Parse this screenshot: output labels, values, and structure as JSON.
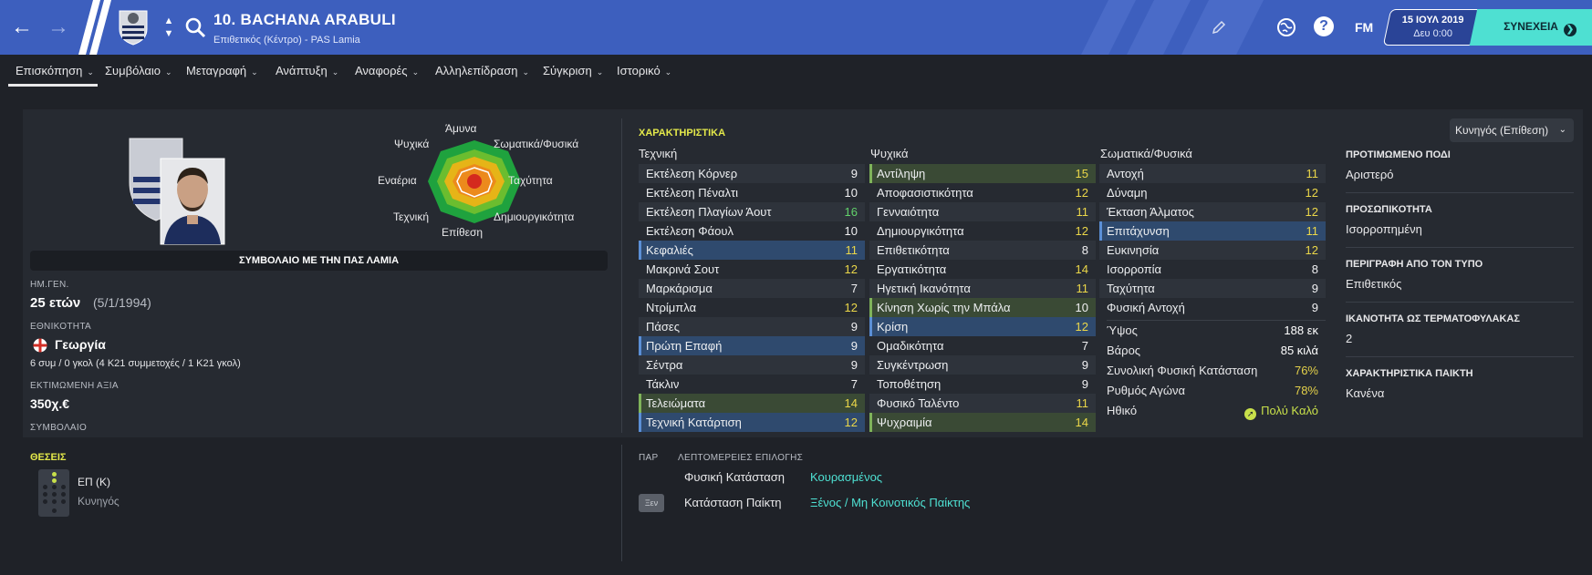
{
  "header": {
    "player_name": "10. BACHANA ARABULI",
    "player_subtitle": "Επιθετικός (Κέντρο) - PAS Lamia",
    "fm_label": "FM",
    "help_label": "?",
    "date": "15 ΙΟΥΛ 2019",
    "day_time": "Δευ 0:00",
    "continue_label": "ΣΥΝΕΧΕΙΑ",
    "accent_color": "#3d5fbe",
    "continue_color": "#4ee0d2"
  },
  "tabs": [
    {
      "label": "Επισκόπηση"
    },
    {
      "label": "Συμβόλαιο"
    },
    {
      "label": "Μεταγραφή"
    },
    {
      "label": "Ανάπτυξη"
    },
    {
      "label": "Αναφορές"
    },
    {
      "label": "Αλληλεπίδραση"
    },
    {
      "label": "Σύγκριση"
    },
    {
      "label": "Ιστορικό"
    }
  ],
  "profile": {
    "contract_banner": "ΣΥΜΒΟΛΑΙΟ ΜΕ ΤΗΝ ΠΑΣ ΛΑΜΙΑ",
    "dob_label": "ΗΜ.ΓΕΝ.",
    "age": "25 ετών",
    "dob": "(5/1/1994)",
    "nationality_label": "ΕΘΝΙΚΟΤΗΤΑ",
    "nationality": "Γεωργία",
    "caps": "6 συμ / 0 γκολ (4 K21 συμμετοχές / 1 K21 γκολ)",
    "value_label": "ΕΚΤΙΜΩΜΕΝΗ ΑΞΙΑ",
    "value": "350χ.€",
    "contract_label": "ΣΥΜΒΟΛΑΙΟ"
  },
  "radar": {
    "top": "Άμυνα",
    "top_right": "Σωματικά/Φυσικά",
    "right": "Ταχύτητα",
    "bottom_right": "Δημιουργικότητα",
    "bottom": "Επίθεση",
    "bottom_left": "Τεχνική",
    "left": "Εναέρια",
    "top_left": "Ψυχικά"
  },
  "attributes": {
    "title": "ΧΑΡΑΚΤΗΡΙΣΤΙΚΑ",
    "technical_head": "Τεχνική",
    "mental_head": "Ψυχικά",
    "physical_head": "Σωματικά/Φυσικά",
    "technical": [
      {
        "name": "Εκτέλεση Κόρνερ",
        "value": "9",
        "hl": ""
      },
      {
        "name": "Εκτέλεση Πέναλτι",
        "value": "10",
        "hl": ""
      },
      {
        "name": "Εκτέλεση Πλαγίων Άουτ",
        "value": "16",
        "hl": ""
      },
      {
        "name": "Εκτέλεση Φάουλ",
        "value": "10",
        "hl": ""
      },
      {
        "name": "Κεφαλιές",
        "value": "11",
        "hl": "blue"
      },
      {
        "name": "Μακρινά Σουτ",
        "value": "12",
        "hl": ""
      },
      {
        "name": "Μαρκάρισμα",
        "value": "7",
        "hl": ""
      },
      {
        "name": "Ντρίμπλα",
        "value": "12",
        "hl": ""
      },
      {
        "name": "Πάσες",
        "value": "9",
        "hl": ""
      },
      {
        "name": "Πρώτη Επαφή",
        "value": "9",
        "hl": "blue"
      },
      {
        "name": "Σέντρα",
        "value": "9",
        "hl": ""
      },
      {
        "name": "Τάκλιν",
        "value": "7",
        "hl": ""
      },
      {
        "name": "Τελειώματα",
        "value": "14",
        "hl": "green"
      },
      {
        "name": "Τεχνική Κατάρτιση",
        "value": "12",
        "hl": "blue"
      }
    ],
    "mental": [
      {
        "name": "Αντίληψη",
        "value": "15",
        "hl": "green"
      },
      {
        "name": "Αποφασιστικότητα",
        "value": "12",
        "hl": ""
      },
      {
        "name": "Γενναιότητα",
        "value": "11",
        "hl": ""
      },
      {
        "name": "Δημιουργικότητα",
        "value": "12",
        "hl": ""
      },
      {
        "name": "Επιθετικότητα",
        "value": "8",
        "hl": ""
      },
      {
        "name": "Εργατικότητα",
        "value": "14",
        "hl": ""
      },
      {
        "name": "Ηγετική Ικανότητα",
        "value": "11",
        "hl": ""
      },
      {
        "name": "Κίνηση Χωρίς την Μπάλα",
        "value": "10",
        "hl": "green"
      },
      {
        "name": "Κρίση",
        "value": "12",
        "hl": "blue"
      },
      {
        "name": "Ομαδικότητα",
        "value": "7",
        "hl": ""
      },
      {
        "name": "Συγκέντρωση",
        "value": "9",
        "hl": ""
      },
      {
        "name": "Τοποθέτηση",
        "value": "9",
        "hl": ""
      },
      {
        "name": "Φυσικό Ταλέντο",
        "value": "11",
        "hl": ""
      },
      {
        "name": "Ψυχραιμία",
        "value": "14",
        "hl": "green"
      }
    ],
    "physical": [
      {
        "name": "Αντοχή",
        "value": "11",
        "hl": ""
      },
      {
        "name": "Δύναμη",
        "value": "12",
        "hl": ""
      },
      {
        "name": "Έκταση Άλματος",
        "value": "12",
        "hl": ""
      },
      {
        "name": "Επιτάχυνση",
        "value": "11",
        "hl": "blue"
      },
      {
        "name": "Ευκινησία",
        "value": "12",
        "hl": ""
      },
      {
        "name": "Ισορροπία",
        "value": "8",
        "hl": ""
      },
      {
        "name": "Ταχύτητα",
        "value": "9",
        "hl": ""
      },
      {
        "name": "Φυσική Αντοχή",
        "value": "9",
        "hl": ""
      }
    ],
    "extra": {
      "height_label": "Ύψος",
      "height": "188 εκ",
      "weight_label": "Βάρος",
      "weight": "85 κιλά",
      "fitness_label": "Συνολική Φυσική Κατάσταση",
      "fitness": "76%",
      "sharpness_label": "Ρυθμός Αγώνα",
      "sharpness": "78%",
      "morale_label": "Ηθικό",
      "morale": "Πολύ Καλό"
    }
  },
  "role_dropdown": "Κυνηγός (Επίθεση)",
  "info": {
    "foot_label": "ΠΡΟΤΙΜΩΜΕΝΟ ΠΟΔΙ",
    "foot": "Αριστερό",
    "personality_label": "ΠΡΟΣΩΠΙΚΟΤΗΤΑ",
    "personality": "Ισορροπημένη",
    "media_label": "ΠΕΡΙΓΡΑΦΗ ΑΠΟ ΤΟΝ ΤΥΠΟ",
    "media": "Επιθετικός",
    "gk_label": "ΙΚΑΝΟΤΗΤΑ ΩΣ ΤΕΡΜΑΤΟΦΥΛΑΚΑΣ",
    "gk": "2",
    "traits_label": "ΧΑΡΑΚΤΗΡΙΣΤΙΚΑ ΠΑΙΚΤΗ",
    "traits": "Κανένα"
  },
  "positions": {
    "title": "ΘΕΣΕΙΣ",
    "position": "ΕΠ (Κ)",
    "role": "Κυνηγός"
  },
  "selection": {
    "col_par": "ΠΑΡ",
    "col_details": "ΛΕΠΤΟΜΕΡΕΙΕΣ ΕΠΙΛΟΓΗΣ",
    "condition_label": "Φυσική Κατάσταση",
    "condition_value": "Κουρασμένος",
    "status_badge": "Ξεν",
    "status_label": "Κατάσταση Παίκτη",
    "status_value": "Ξένος / Μη Κοινοτικός Παίκτης"
  }
}
